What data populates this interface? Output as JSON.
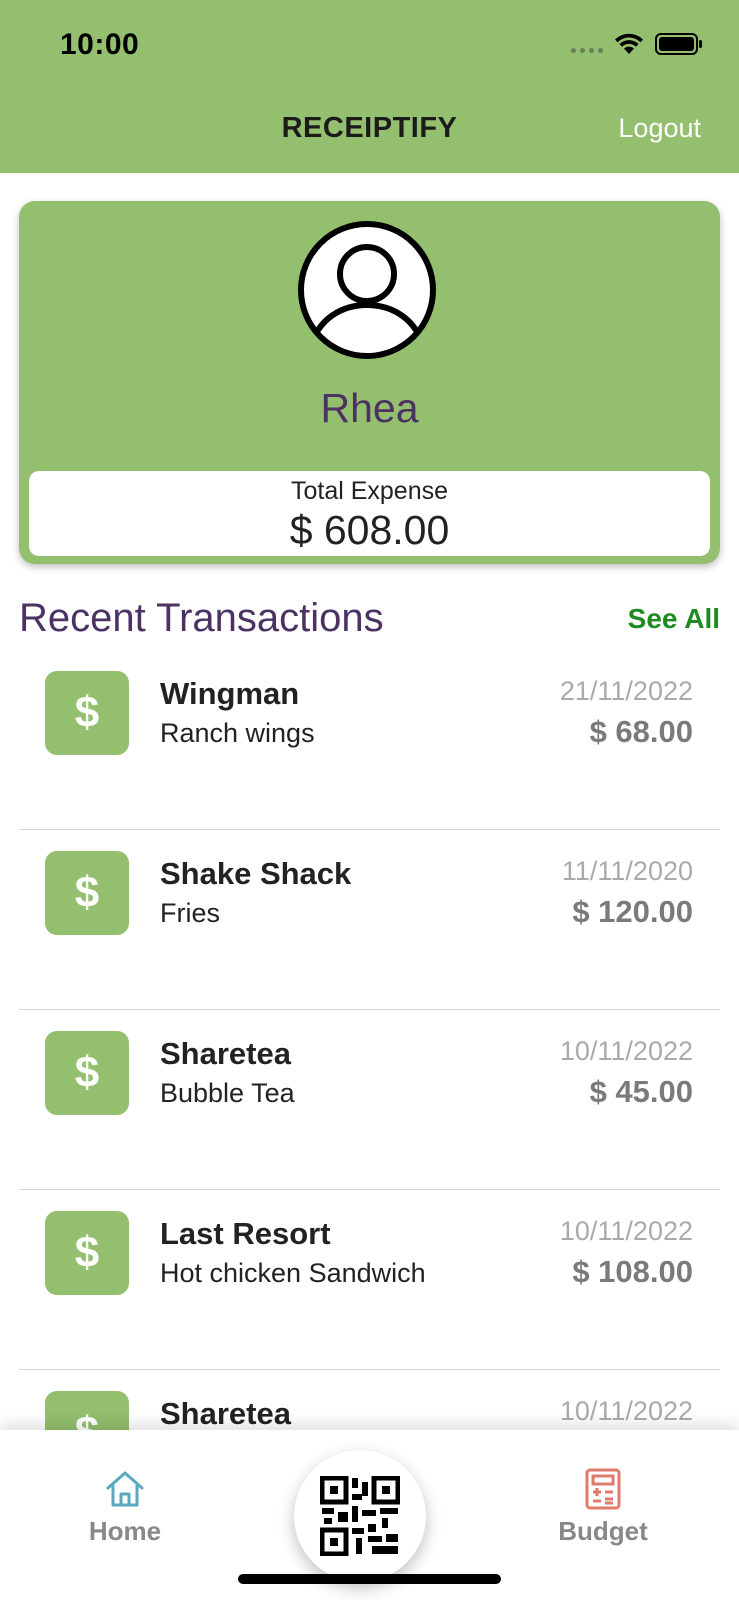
{
  "status_bar": {
    "time": "10:00"
  },
  "header": {
    "title": "RECEIPTIFY",
    "logout_label": "Logout"
  },
  "profile": {
    "name": "Rhea",
    "expense_label": "Total Expense",
    "expense_value": "$ 608.00"
  },
  "transactions": {
    "title": "Recent Transactions",
    "see_all_label": "See All",
    "items": [
      {
        "merchant": "Wingman",
        "item": "Ranch wings",
        "date": "21/11/2022",
        "amount": "$ 68.00"
      },
      {
        "merchant": "Shake Shack",
        "item": "Fries",
        "date": "11/11/2020",
        "amount": "$ 120.00"
      },
      {
        "merchant": "Sharetea",
        "item": "Bubble Tea",
        "date": "10/11/2022",
        "amount": "$ 45.00"
      },
      {
        "merchant": "Last Resort",
        "item": "Hot chicken Sandwich",
        "date": "10/11/2022",
        "amount": "$ 108.00"
      },
      {
        "merchant": "Sharetea",
        "item": "",
        "date": "10/11/2022",
        "amount": ""
      }
    ]
  },
  "tabbar": {
    "home_label": "Home",
    "budget_label": "Budget",
    "icons": [
      "home-icon",
      "qr-code-icon",
      "budget-calculator-icon"
    ]
  },
  "colors": {
    "brand_green": "#93bf6e",
    "name_purple": "#4c3163",
    "see_all_green": "#1f8a1f",
    "budget_icon": "#e07a6b",
    "home_icon": "#5aa9c0"
  }
}
